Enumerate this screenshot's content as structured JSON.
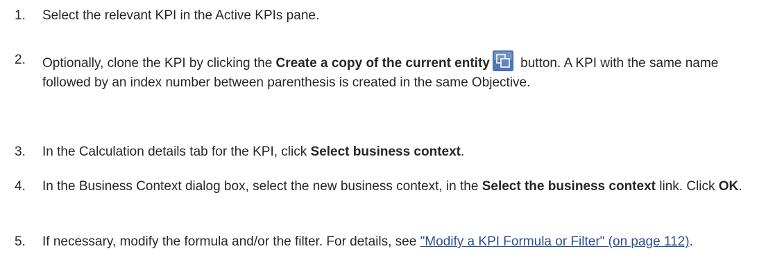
{
  "steps": [
    {
      "number": "1.",
      "text": "Select the relevant KPI in the Active KPIs pane."
    },
    {
      "number": "2.",
      "text_before": "Optionally, clone the KPI by clicking the ",
      "bold": "Create a copy of the current entity",
      "icon": "copy-entity-icon",
      "text_after": " button. A KPI with the same name followed by an index number between parenthesis is created in the same Objective."
    },
    {
      "number": "3.",
      "text_before": "In the Calculation details tab for the KPI, click ",
      "bold": "Select business context",
      "text_after": "."
    },
    {
      "number": "4.",
      "text_before": "In the Business Context dialog box, select the new business context, in the ",
      "bold": "Select the business context",
      "text_middle": " link. Click ",
      "bold2": "OK",
      "text_after": "."
    },
    {
      "number": "5.",
      "text_before": "If necessary, modify the formula and/or the filter. For details, see ",
      "link": "\"Modify a KPI Formula or Filter\" (on page 112)",
      "text_after": "."
    }
  ],
  "colors": {
    "text": "#262626",
    "link": "#2a4f8f",
    "icon_blue": "#4f78b5"
  }
}
